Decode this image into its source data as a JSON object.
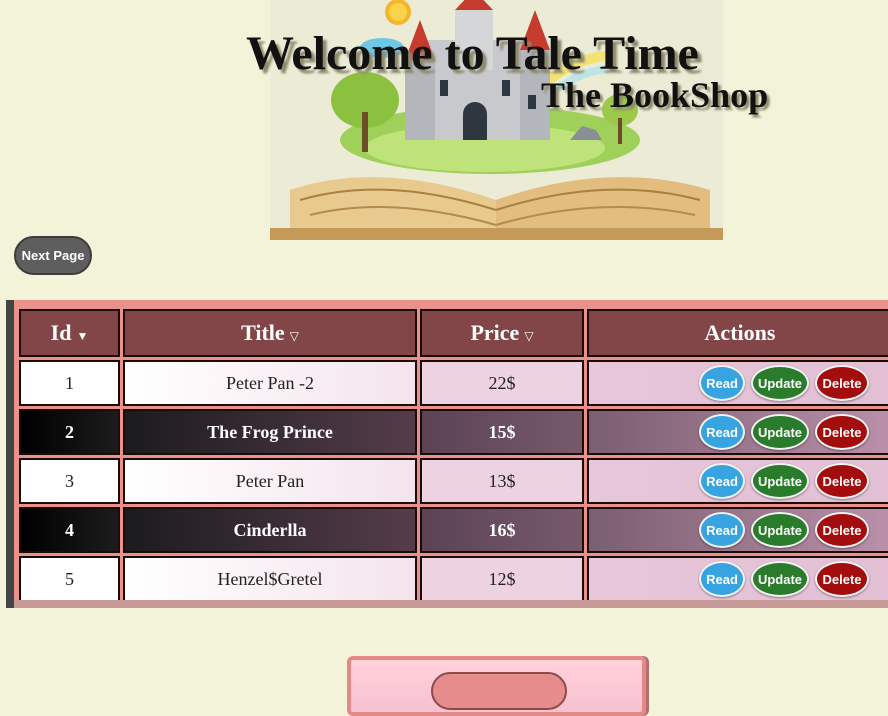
{
  "header": {
    "title": "Welcome to Tale Time",
    "subtitle": "The BookShop"
  },
  "nav": {
    "next_page_label": "Next Page"
  },
  "table": {
    "columns": [
      {
        "label": "Id",
        "sort_icon": "▼"
      },
      {
        "label": "Title",
        "sort_icon": "▽"
      },
      {
        "label": "Price",
        "sort_icon": "▽"
      },
      {
        "label": "Actions",
        "sort_icon": ""
      }
    ],
    "rows": [
      {
        "id": "1",
        "title": "Peter Pan -2",
        "price": "22$"
      },
      {
        "id": "2",
        "title": "The Frog Prince",
        "price": "15$"
      },
      {
        "id": "3",
        "title": "Peter Pan",
        "price": "13$"
      },
      {
        "id": "4",
        "title": "Cinderlla",
        "price": "16$"
      },
      {
        "id": "5",
        "title": "Henzel$Gretel",
        "price": "12$"
      }
    ],
    "actions": {
      "read": "Read",
      "update": "Update",
      "delete": "Delete"
    }
  },
  "colors": {
    "page_background": "#f3f3d9",
    "header_cell": "#824648",
    "read_button": "#37a3e1",
    "update_button": "#2a7c2c",
    "delete_button": "#a30d0d",
    "table_frame": "#e9918a"
  },
  "icons": {
    "hero": "storybook-castle-illustration",
    "sort_desc": "sort-down-icon",
    "sort": "sort-icon"
  }
}
